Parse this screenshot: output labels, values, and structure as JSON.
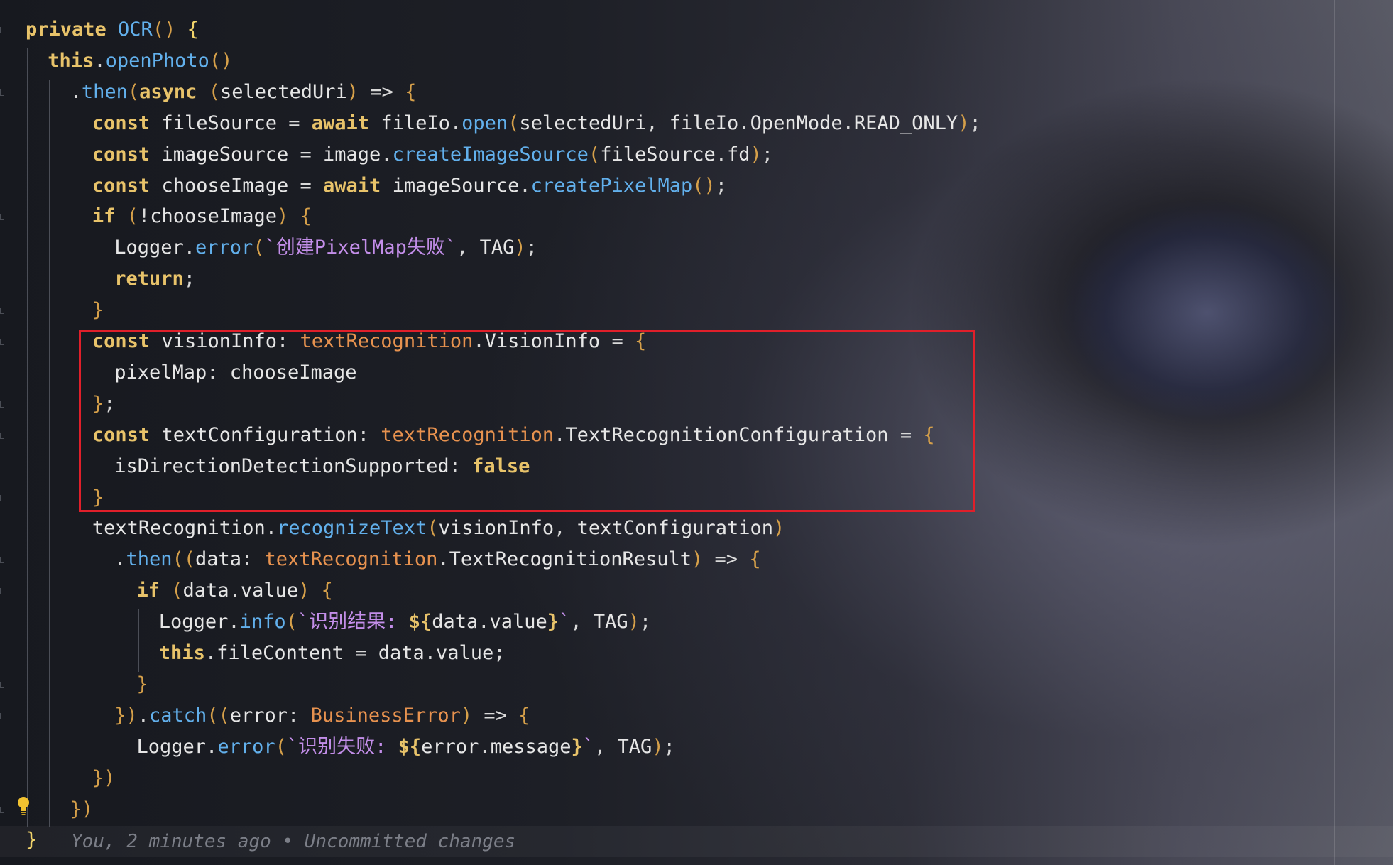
{
  "colors": {
    "keyword": "#e8c36a",
    "function": "#62b0ec",
    "type": "#e7924f",
    "string": "#c38ee9",
    "plain": "#e6e6e6",
    "highlight_box": "#e01f2a",
    "blame": "#7b7e87"
  },
  "editor": {
    "lightbulb_icon": "lightbulb-icon",
    "lines": [
      [
        [
          "kw",
          "private "
        ],
        [
          "fn",
          "OCR"
        ],
        [
          "par",
          "() "
        ],
        [
          "br1",
          "{"
        ]
      ],
      [
        [
          "kw",
          "this"
        ],
        [
          "pl",
          "."
        ],
        [
          "fn",
          "openPhoto"
        ],
        [
          "par",
          "()"
        ]
      ],
      [
        [
          "pl",
          "."
        ],
        [
          "fn",
          "then"
        ],
        [
          "par",
          "("
        ],
        [
          "kw",
          "async "
        ],
        [
          "par",
          "("
        ],
        [
          "var",
          "selectedUri"
        ],
        [
          "par",
          ") "
        ],
        [
          "pl",
          "=> "
        ],
        [
          "par",
          "{"
        ]
      ],
      [
        [
          "kw",
          "const "
        ],
        [
          "var",
          "fileSource "
        ],
        [
          "pl",
          "= "
        ],
        [
          "kw",
          "await "
        ],
        [
          "var",
          "fileIo"
        ],
        [
          "pl",
          "."
        ],
        [
          "fn",
          "open"
        ],
        [
          "par",
          "("
        ],
        [
          "var",
          "selectedUri"
        ],
        [
          "pl",
          ", "
        ],
        [
          "var",
          "fileIo"
        ],
        [
          "pl",
          "."
        ],
        [
          "var",
          "OpenMode"
        ],
        [
          "pl",
          "."
        ],
        [
          "var",
          "READ_ONLY"
        ],
        [
          "par",
          ")"
        ],
        [
          "pl",
          ";"
        ]
      ],
      [
        [
          "kw",
          "const "
        ],
        [
          "var",
          "imageSource "
        ],
        [
          "pl",
          "= "
        ],
        [
          "var",
          "image"
        ],
        [
          "pl",
          "."
        ],
        [
          "fn",
          "createImageSource"
        ],
        [
          "par",
          "("
        ],
        [
          "var",
          "fileSource"
        ],
        [
          "pl",
          "."
        ],
        [
          "var",
          "fd"
        ],
        [
          "par",
          ")"
        ],
        [
          "pl",
          ";"
        ]
      ],
      [
        [
          "kw",
          "const "
        ],
        [
          "var",
          "chooseImage "
        ],
        [
          "pl",
          "= "
        ],
        [
          "kw",
          "await "
        ],
        [
          "var",
          "imageSource"
        ],
        [
          "pl",
          "."
        ],
        [
          "fn",
          "createPixelMap"
        ],
        [
          "par",
          "()"
        ],
        [
          "pl",
          ";"
        ]
      ],
      [
        [
          "kw",
          "if "
        ],
        [
          "par",
          "("
        ],
        [
          "pl",
          "!"
        ],
        [
          "var",
          "chooseImage"
        ],
        [
          "par",
          ") "
        ],
        [
          "par",
          "{"
        ]
      ],
      [
        [
          "var",
          "Logger"
        ],
        [
          "pl",
          "."
        ],
        [
          "fn",
          "error"
        ],
        [
          "par",
          "("
        ],
        [
          "str",
          "`创建PixelMap失败`"
        ],
        [
          "pl",
          ", "
        ],
        [
          "var",
          "TAG"
        ],
        [
          "par",
          ")"
        ],
        [
          "pl",
          ";"
        ]
      ],
      [
        [
          "kw",
          "return"
        ],
        [
          "pl",
          ";"
        ]
      ],
      [
        [
          "par",
          "}"
        ]
      ],
      [
        [
          "kw",
          "const "
        ],
        [
          "var",
          "visionInfo"
        ],
        [
          "pl",
          ": "
        ],
        [
          "ty",
          "textRecognition"
        ],
        [
          "pl",
          "."
        ],
        [
          "var",
          "VisionInfo "
        ],
        [
          "pl",
          "= "
        ],
        [
          "par",
          "{"
        ]
      ],
      [
        [
          "var",
          "pixelMap"
        ],
        [
          "pl",
          ": "
        ],
        [
          "var",
          "chooseImage"
        ]
      ],
      [
        [
          "par",
          "}"
        ],
        [
          "pl",
          ";"
        ]
      ],
      [
        [
          "kw",
          "const "
        ],
        [
          "var",
          "textConfiguration"
        ],
        [
          "pl",
          ": "
        ],
        [
          "ty",
          "textRecognition"
        ],
        [
          "pl",
          "."
        ],
        [
          "var",
          "TextRecognitionConfiguration "
        ],
        [
          "pl",
          "= "
        ],
        [
          "par",
          "{"
        ]
      ],
      [
        [
          "var",
          "isDirectionDetectionSupported"
        ],
        [
          "pl",
          ": "
        ],
        [
          "kw",
          "false"
        ]
      ],
      [
        [
          "par",
          "}"
        ]
      ],
      [
        [
          "var",
          "textRecognition"
        ],
        [
          "pl",
          "."
        ],
        [
          "fn",
          "recognizeText"
        ],
        [
          "par",
          "("
        ],
        [
          "var",
          "visionInfo"
        ],
        [
          "pl",
          ", "
        ],
        [
          "var",
          "textConfiguration"
        ],
        [
          "par",
          ")"
        ]
      ],
      [
        [
          "pl",
          "."
        ],
        [
          "fn",
          "then"
        ],
        [
          "par",
          "(("
        ],
        [
          "var",
          "data"
        ],
        [
          "pl",
          ": "
        ],
        [
          "ty",
          "textRecognition"
        ],
        [
          "pl",
          "."
        ],
        [
          "var",
          "TextRecognitionResult"
        ],
        [
          "par",
          ") "
        ],
        [
          "pl",
          "=> "
        ],
        [
          "par",
          "{"
        ]
      ],
      [
        [
          "kw",
          "if "
        ],
        [
          "par",
          "("
        ],
        [
          "var",
          "data"
        ],
        [
          "pl",
          "."
        ],
        [
          "var",
          "value"
        ],
        [
          "par",
          ") "
        ],
        [
          "par",
          "{"
        ]
      ],
      [
        [
          "var",
          "Logger"
        ],
        [
          "pl",
          "."
        ],
        [
          "fn",
          "info"
        ],
        [
          "par",
          "("
        ],
        [
          "str",
          "`识别结果: "
        ],
        [
          "kw",
          "${"
        ],
        [
          "var",
          "data"
        ],
        [
          "pl",
          "."
        ],
        [
          "var",
          "value"
        ],
        [
          "kw",
          "}"
        ],
        [
          "str",
          "`"
        ],
        [
          "pl",
          ", "
        ],
        [
          "var",
          "TAG"
        ],
        [
          "par",
          ")"
        ],
        [
          "pl",
          ";"
        ]
      ],
      [
        [
          "kw",
          "this"
        ],
        [
          "pl",
          "."
        ],
        [
          "var",
          "fileContent "
        ],
        [
          "pl",
          "= "
        ],
        [
          "var",
          "data"
        ],
        [
          "pl",
          "."
        ],
        [
          "var",
          "value"
        ],
        [
          "pl",
          ";"
        ]
      ],
      [
        [
          "par",
          "}"
        ]
      ],
      [
        [
          "par",
          "})"
        ],
        [
          "pl",
          "."
        ],
        [
          "fn",
          "catch"
        ],
        [
          "par",
          "(("
        ],
        [
          "var",
          "error"
        ],
        [
          "pl",
          ": "
        ],
        [
          "ty",
          "BusinessError"
        ],
        [
          "par",
          ") "
        ],
        [
          "pl",
          "=> "
        ],
        [
          "par",
          "{"
        ]
      ],
      [
        [
          "var",
          "Logger"
        ],
        [
          "pl",
          "."
        ],
        [
          "fn",
          "error"
        ],
        [
          "par",
          "("
        ],
        [
          "str",
          "`识别失败: "
        ],
        [
          "kw",
          "${"
        ],
        [
          "var",
          "error"
        ],
        [
          "pl",
          "."
        ],
        [
          "var",
          "message"
        ],
        [
          "kw",
          "}"
        ],
        [
          "str",
          "`"
        ],
        [
          "pl",
          ", "
        ],
        [
          "var",
          "TAG"
        ],
        [
          "par",
          ")"
        ],
        [
          "pl",
          ";"
        ]
      ],
      [
        [
          "par",
          "})"
        ]
      ],
      [
        [
          "par",
          "})"
        ]
      ],
      [
        [
          "br1",
          "}"
        ]
      ]
    ],
    "blame": "You, 2 minutes ago • Uncommitted changes"
  }
}
